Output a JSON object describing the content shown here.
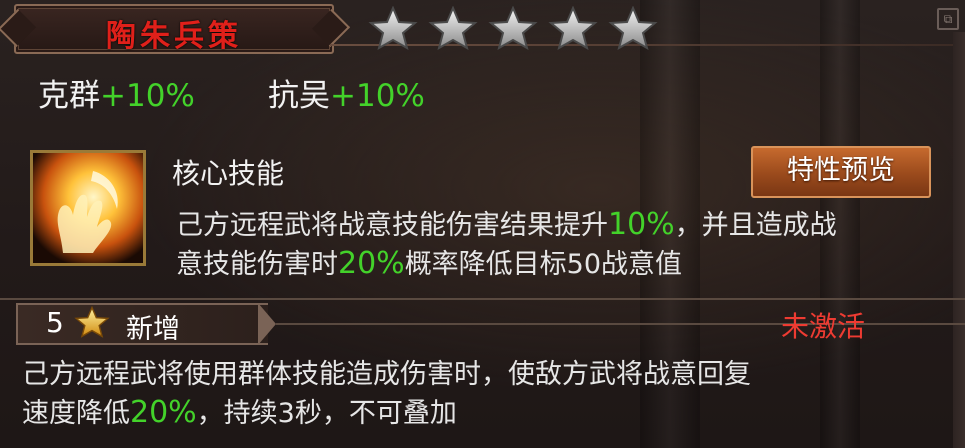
{
  "header": {
    "title": "陶朱兵策",
    "star_count": 5,
    "star_color": "#c8c8c8",
    "title_color": "#e0201a"
  },
  "bonuses": [
    {
      "label": "克群",
      "value": "+10%"
    },
    {
      "label": "抗吴",
      "value": "+10%"
    }
  ],
  "core_skill": {
    "icon": "flame-hand-icon",
    "name": "核心技能",
    "preview_button": "特性预览",
    "desc": [
      "己方远程武将战意技能伤害结果提升",
      "10%",
      "，并且造成战",
      "意技能伤害时",
      "20%",
      "概率降低目标50战意值"
    ]
  },
  "tier": {
    "level": "5",
    "label": "新增",
    "status": "未激活",
    "status_color": "#ee3b32",
    "desc": [
      "己方远程武将使用群体技能造成伤害时，使敌方武将战意回复",
      "速度降低",
      "20%",
      "，持续3秒，不可叠加"
    ]
  },
  "colors": {
    "highlight": "#43d22a",
    "text": "#e6e6e6"
  }
}
